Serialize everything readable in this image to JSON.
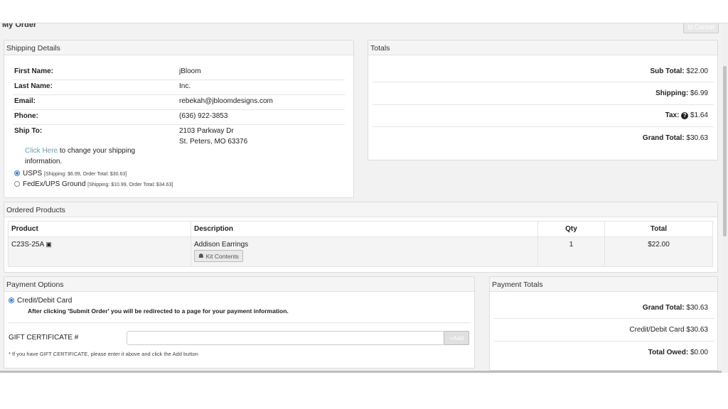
{
  "page": {
    "title": "My Order",
    "cancel_label": "Cancel"
  },
  "shipping": {
    "heading": "Shipping Details",
    "fields": [
      {
        "label": "First Name:",
        "value": "jBloom"
      },
      {
        "label": "Last Name:",
        "value": "Inc."
      },
      {
        "label": "Email:",
        "value": "rebekah@jbloomdesigns.com"
      },
      {
        "label": "Phone:",
        "value": "(636) 922-3853"
      }
    ],
    "ship_to_label": "Ship To:",
    "address_line1": "2103 Parkway Dr",
    "address_line2": "St. Peters, MO 63376",
    "change_link": "Click Here",
    "change_text_1": " to change your shipping",
    "change_text_2": "information.",
    "options": [
      {
        "label": "USPS",
        "detail": "[Shipping: $6.99, Order Total: $30.63]",
        "selected": true
      },
      {
        "label": "FedEx/UPS Ground",
        "detail": "[Shipping: $10.99, Order Total: $34.63]",
        "selected": false
      }
    ]
  },
  "totals": {
    "heading": "Totals",
    "sub_total_label": "Sub Total:",
    "sub_total": "$22.00",
    "shipping_label": "Shipping:",
    "shipping": "$6.99",
    "tax_label": "Tax:",
    "tax": "$1.64",
    "grand_total_label": "Grand Total:",
    "grand_total": "$30.63"
  },
  "products": {
    "heading": "Ordered Products",
    "columns": [
      "Product",
      "Description",
      "Qty",
      "Total"
    ],
    "rows": [
      {
        "product": "C23S-25A",
        "description": "Addison Earrings",
        "kit_label": "Kit Contents",
        "qty": "1",
        "total": "$22.00"
      }
    ]
  },
  "payment": {
    "heading": "Payment Options",
    "method": "Credit/Debit Card",
    "note": "After clicking 'Submit Order' you will be redirected to a page for your payment information.",
    "gift_label": "GIFT CERTIFICATE #",
    "gift_value": "",
    "add_label": "Add",
    "gift_hint": "* If you have GIFT CERTIFICATE, please enter it above and click the Add button"
  },
  "payment_totals": {
    "heading": "Payment Totals",
    "grand_total_label": "Grand Total:",
    "grand_total": "$30.63",
    "card_label": "Credit/Debit Card",
    "card_amount": "$30.63",
    "owed_label": "Total Owed:",
    "owed": "$0.00"
  }
}
